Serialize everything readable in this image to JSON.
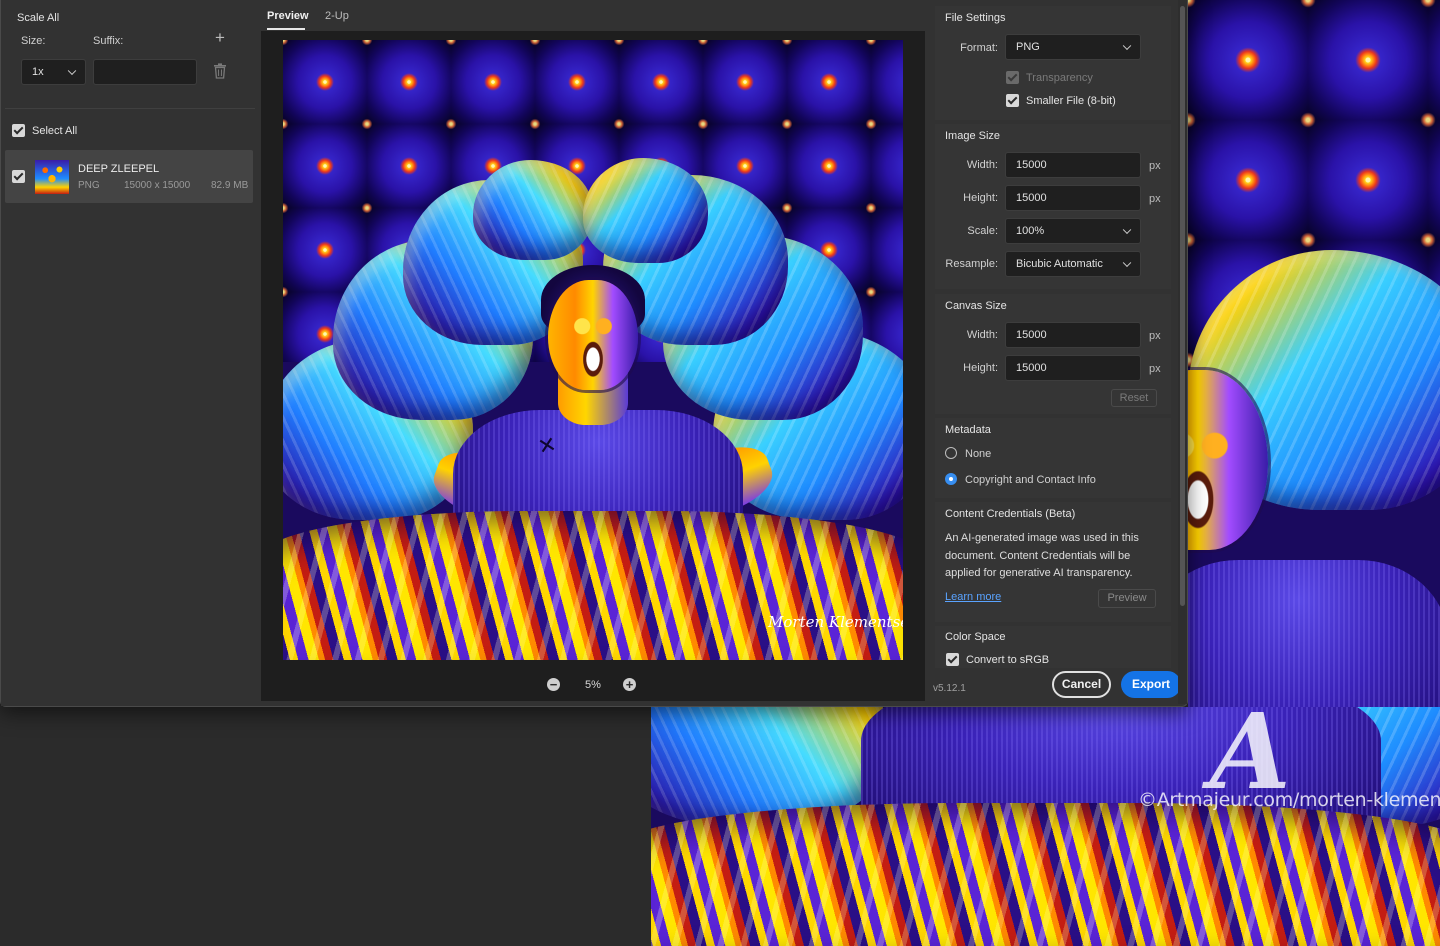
{
  "left_panel": {
    "title": "Scale All",
    "size_label": "Size:",
    "suffix_label": "Suffix:",
    "scale_value": "1x",
    "suffix_value": "",
    "select_all_label": "Select All",
    "asset": {
      "name": "DEEP ZLEEPEL",
      "format": "PNG",
      "dimensions": "15000 x 15000",
      "file_size": "82.9 MB"
    }
  },
  "tabs": [
    "Preview",
    "2-Up"
  ],
  "zoom": {
    "value": "5%"
  },
  "artwork": {
    "signature": "Morten Klementsen"
  },
  "file_settings": {
    "title": "File Settings",
    "format_label": "Format:",
    "format_value": "PNG",
    "transparency_label": "Transparency",
    "smaller_file_label": "Smaller File (8-bit)"
  },
  "image_size": {
    "title": "Image Size",
    "width_label": "Width:",
    "width_value": "15000",
    "height_label": "Height:",
    "height_value": "15000",
    "unit": "px",
    "scale_label": "Scale:",
    "scale_value": "100%",
    "resample_label": "Resample:",
    "resample_value": "Bicubic Automatic"
  },
  "canvas_size": {
    "title": "Canvas Size",
    "width_label": "Width:",
    "width_value": "15000",
    "height_label": "Height:",
    "height_value": "15000",
    "unit": "px",
    "reset_label": "Reset"
  },
  "metadata": {
    "title": "Metadata",
    "options": [
      "None",
      "Copyright and Contact Info"
    ]
  },
  "content_credentials": {
    "title": "Content Credentials (Beta)",
    "text": "An AI-generated image was used in this document. Content Credentials will be applied for generative AI transparency.",
    "learn_more": "Learn more",
    "preview_label": "Preview"
  },
  "color_space": {
    "title": "Color Space",
    "convert_label": "Convert to sRGB"
  },
  "footer": {
    "version": "v5.12.1",
    "cancel_label": "Cancel",
    "export_label": "Export"
  },
  "watermark": {
    "mark": "A",
    "text": "©Artmajeur.com/morten-klementsen"
  },
  "colors": {
    "accent": "#1473e6",
    "dialog_bg": "#323232",
    "preview_bg": "#1e1e1e"
  }
}
